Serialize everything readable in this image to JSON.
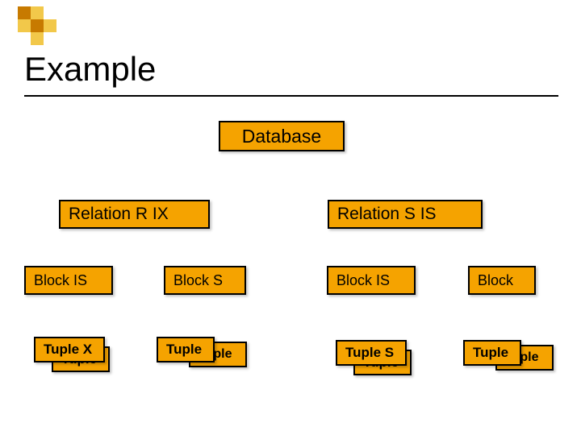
{
  "title": "Example",
  "database": {
    "label": "Database"
  },
  "relations": [
    {
      "label": "Relation R  IX"
    },
    {
      "label": "Relation S   IS"
    }
  ],
  "blocks": [
    {
      "label": "Block IS"
    },
    {
      "label": "Block S"
    },
    {
      "label": "Block IS"
    },
    {
      "label": "Block"
    }
  ],
  "tuples": [
    {
      "front": "Tuple X",
      "behind": "Tuple"
    },
    {
      "front": "Tuple",
      "behind": "Tuple"
    },
    {
      "front": "Tuple S",
      "behind": "Tuple"
    },
    {
      "front": "Tuple",
      "behind": "Tuple"
    }
  ]
}
